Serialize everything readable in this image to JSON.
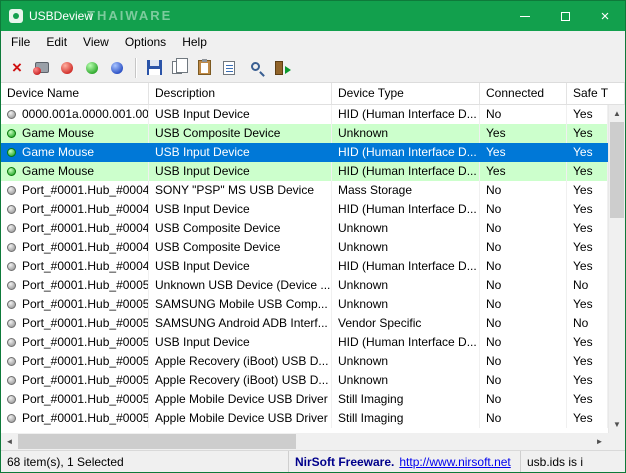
{
  "window": {
    "title": "USBDeview",
    "watermark": "THAIWARE"
  },
  "menu": {
    "items": [
      "File",
      "Edit",
      "View",
      "Options",
      "Help"
    ]
  },
  "toolbar": {
    "icons": [
      "delete-icon",
      "uninstall-device-icon",
      "red-ball-icon",
      "green-ball-icon",
      "blue-ball-icon",
      "save-icon",
      "copy-icon",
      "clipboard-icon",
      "properties-icon",
      "find-icon",
      "exit-icon"
    ]
  },
  "table": {
    "columns": [
      {
        "label": "Device Name"
      },
      {
        "label": "Description"
      },
      {
        "label": "Device Type"
      },
      {
        "label": "Connected"
      },
      {
        "label": "Safe T"
      }
    ],
    "rows": [
      {
        "icon": "gray",
        "highlight": "none",
        "name": "0000.001a.0000.001.00...",
        "description": "USB Input Device",
        "device_type": "HID (Human Interface D...",
        "connected": "No",
        "safe": "Yes"
      },
      {
        "icon": "green",
        "highlight": "connected",
        "name": "Game Mouse",
        "description": "USB Composite Device",
        "device_type": "Unknown",
        "connected": "Yes",
        "safe": "Yes"
      },
      {
        "icon": "green",
        "highlight": "selected",
        "name": "Game Mouse",
        "description": "USB Input Device",
        "device_type": "HID (Human Interface D...",
        "connected": "Yes",
        "safe": "Yes"
      },
      {
        "icon": "green",
        "highlight": "connected",
        "name": "Game Mouse",
        "description": "USB Input Device",
        "device_type": "HID (Human Interface D...",
        "connected": "Yes",
        "safe": "Yes"
      },
      {
        "icon": "gray",
        "highlight": "none",
        "name": "Port_#0001.Hub_#0004",
        "description": "SONY \"PSP\" MS USB Device",
        "device_type": "Mass Storage",
        "connected": "No",
        "safe": "Yes"
      },
      {
        "icon": "gray",
        "highlight": "none",
        "name": "Port_#0001.Hub_#0004",
        "description": "USB Input Device",
        "device_type": "HID (Human Interface D...",
        "connected": "No",
        "safe": "Yes"
      },
      {
        "icon": "gray",
        "highlight": "none",
        "name": "Port_#0001.Hub_#0004",
        "description": "USB Composite Device",
        "device_type": "Unknown",
        "connected": "No",
        "safe": "Yes"
      },
      {
        "icon": "gray",
        "highlight": "none",
        "name": "Port_#0001.Hub_#0004",
        "description": "USB Composite Device",
        "device_type": "Unknown",
        "connected": "No",
        "safe": "Yes"
      },
      {
        "icon": "gray",
        "highlight": "none",
        "name": "Port_#0001.Hub_#0004",
        "description": "USB Input Device",
        "device_type": "HID (Human Interface D...",
        "connected": "No",
        "safe": "Yes"
      },
      {
        "icon": "gray",
        "highlight": "none",
        "name": "Port_#0001.Hub_#0005",
        "description": "Unknown USB Device (Device ...",
        "device_type": "Unknown",
        "connected": "No",
        "safe": "No"
      },
      {
        "icon": "gray",
        "highlight": "none",
        "name": "Port_#0001.Hub_#0005",
        "description": "SAMSUNG Mobile USB Comp...",
        "device_type": "Unknown",
        "connected": "No",
        "safe": "Yes"
      },
      {
        "icon": "gray",
        "highlight": "none",
        "name": "Port_#0001.Hub_#0005",
        "description": "SAMSUNG Android ADB Interf...",
        "device_type": "Vendor Specific",
        "connected": "No",
        "safe": "No"
      },
      {
        "icon": "gray",
        "highlight": "none",
        "name": "Port_#0001.Hub_#0005",
        "description": "USB Input Device",
        "device_type": "HID (Human Interface D...",
        "connected": "No",
        "safe": "Yes"
      },
      {
        "icon": "gray",
        "highlight": "none",
        "name": "Port_#0001.Hub_#0005",
        "description": "Apple Recovery (iBoot) USB D...",
        "device_type": "Unknown",
        "connected": "No",
        "safe": "Yes"
      },
      {
        "icon": "gray",
        "highlight": "none",
        "name": "Port_#0001.Hub_#0005",
        "description": "Apple Recovery (iBoot) USB D...",
        "device_type": "Unknown",
        "connected": "No",
        "safe": "Yes"
      },
      {
        "icon": "gray",
        "highlight": "none",
        "name": "Port_#0001.Hub_#0005",
        "description": "Apple Mobile Device USB Driver",
        "device_type": "Still Imaging",
        "connected": "No",
        "safe": "Yes"
      },
      {
        "icon": "gray",
        "highlight": "none",
        "name": "Port_#0001.Hub_#0005",
        "description": "Apple Mobile Device USB Driver",
        "device_type": "Still Imaging",
        "connected": "No",
        "safe": "Yes"
      }
    ]
  },
  "statusbar": {
    "items_text": "68 item(s), 1 Selected",
    "freeware_label": "NirSoft Freeware.",
    "url": "http://www.nirsoft.net",
    "right_text": "usb.ids is i"
  }
}
